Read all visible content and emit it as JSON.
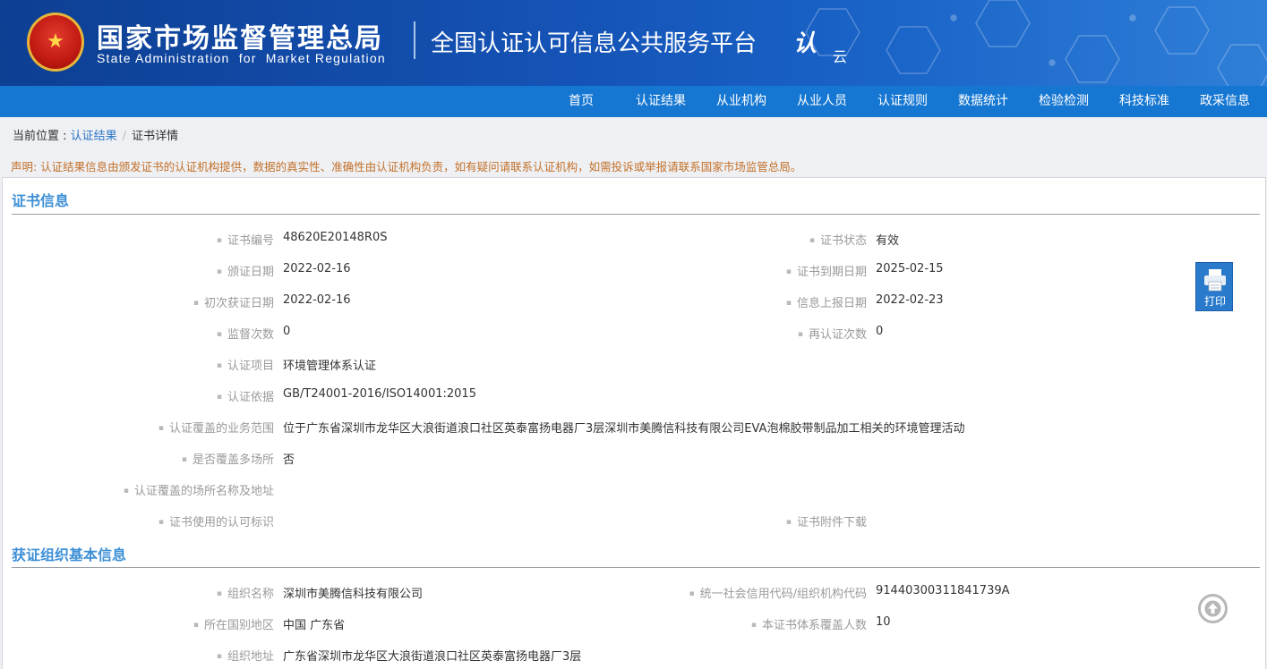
{
  "header": {
    "brand_cn": "国家市场监督管理总局",
    "brand_en": "State Administration  for  Market Regulation",
    "platform": "全国认证认可信息公共服务平台",
    "logo_ren": "认",
    "logo_yun": "云"
  },
  "nav": {
    "items": [
      "首页",
      "认证结果",
      "从业机构",
      "从业人员",
      "认证规则",
      "数据统计",
      "检验检测",
      "科技标准",
      "政采信息"
    ]
  },
  "breadcrumb": {
    "prefix": "当前位置 : ",
    "link": "认证结果",
    "sep": "/",
    "current": "证书详情"
  },
  "notice": "声明: 认证结果信息由颁发证书的认证机构提供，数据的真实性、准确性由认证机构负责，如有疑问请联系认证机构，如需投诉或举报请联系国家市场监管总局。",
  "cert_section": {
    "title": "证书信息",
    "fields": [
      {
        "label": "证书编号",
        "value": "48620E20148R0S"
      },
      {
        "label": "证书状态",
        "value": "有效"
      },
      {
        "label": "颁证日期",
        "value": "2022-02-16"
      },
      {
        "label": "证书到期日期",
        "value": "2025-02-15"
      },
      {
        "label": "初次获证日期",
        "value": "2022-02-16"
      },
      {
        "label": "信息上报日期",
        "value": "2022-02-23"
      },
      {
        "label": "监督次数",
        "value": "0"
      },
      {
        "label": "再认证次数",
        "value": "0"
      },
      {
        "label": "认证项目",
        "value": "环境管理体系认证"
      },
      {
        "label": "认证依据",
        "value": "GB/T24001-2016/ISO14001:2015"
      },
      {
        "label": "认证覆盖的业务范围",
        "value": "位于广东省深圳市龙华区大浪街道浪口社区英泰富扬电器厂3层深圳市美腾信科技有限公司EVA泡棉胶带制品加工相关的环境管理活动"
      },
      {
        "label": "是否覆盖多场所",
        "value": "否"
      },
      {
        "label": "认证覆盖的场所名称及地址",
        "value": ""
      },
      {
        "label": "证书使用的认可标识",
        "value": ""
      },
      {
        "label": "证书附件下载",
        "value": ""
      }
    ]
  },
  "org_section": {
    "title": "获证组织基本信息",
    "fields": [
      {
        "label": "组织名称",
        "value": "深圳市美腾信科技有限公司"
      },
      {
        "label": "统一社会信用代码/组织机构代码",
        "value": "91440300311841739A"
      },
      {
        "label": "所在国别地区",
        "value": "中国 广东省"
      },
      {
        "label": "本证书体系覆盖人数",
        "value": "10"
      },
      {
        "label": "组织地址",
        "value": "广东省深圳市龙华区大浪街道浪口社区英泰富扬电器厂3层"
      }
    ]
  },
  "print_label": "打印",
  "colors": {
    "banner": "#1553b6",
    "nav": "#1677d2",
    "section_title": "#3c8fd6",
    "notice": "#c4712b",
    "link": "#2b74c7"
  }
}
